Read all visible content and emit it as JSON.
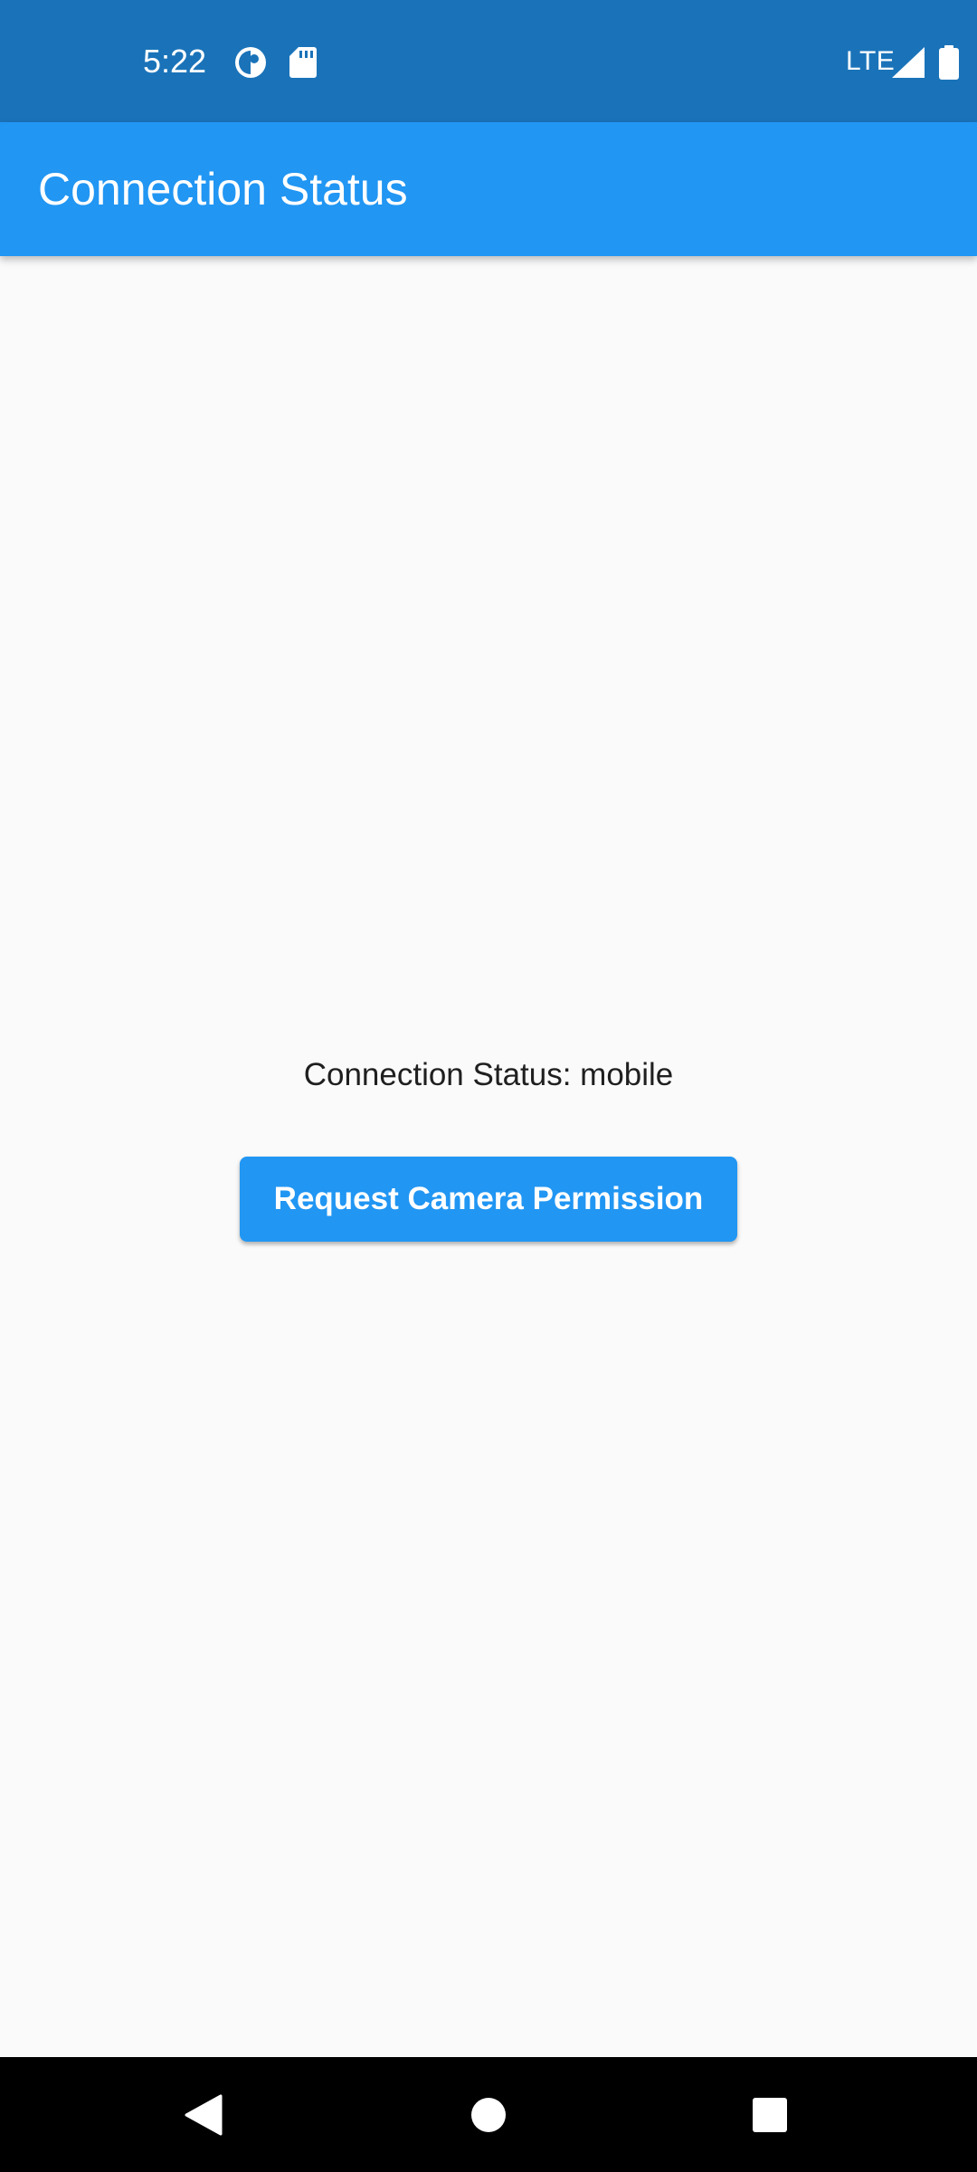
{
  "status_bar": {
    "time": "5:22",
    "network": "LTE",
    "icons": [
      "data-saver-icon",
      "sd-card-icon",
      "signal-icon",
      "battery-icon"
    ]
  },
  "app_bar": {
    "title": "Connection Status"
  },
  "main": {
    "status_text": "Connection Status: mobile",
    "request_button_label": "Request Camera Permission"
  },
  "nav_bar": {
    "icons": [
      "back-icon",
      "home-icon",
      "recents-icon"
    ]
  },
  "colors": {
    "status_bar": "#1a73b9",
    "app_bar": "#2196f3",
    "button": "#2196f3",
    "background": "#fafafa",
    "nav_bar": "#000000"
  }
}
